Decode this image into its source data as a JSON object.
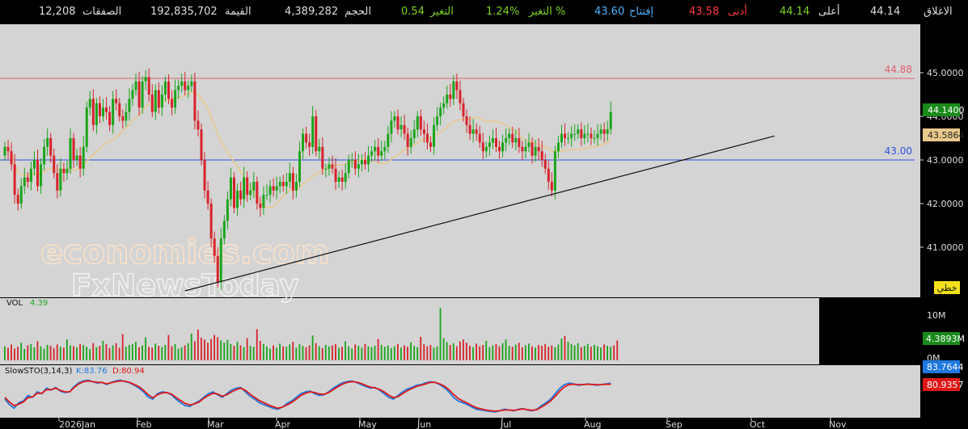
{
  "quote_bar": {
    "close_label": "الاغلاق",
    "close_value": "44.14",
    "high_label": "أعلى",
    "high_value": "44.14",
    "low_label": "أدنى",
    "low_value": "43.58",
    "open_label": "إفتتاح",
    "open_value": "43.60",
    "change_pct_label": "التغير %",
    "change_pct_value": "1.24%",
    "change_label": "التغير",
    "change_value": "0.54",
    "volume_label": "الحجم",
    "volume_value": "4,389,282",
    "value_label": "القيمة",
    "value_value": "192,835,702",
    "trades_label": "الصفقات",
    "trades_value": "12,208"
  },
  "colors": {
    "up": "#1aa51a",
    "down": "#d8222a",
    "panel_bg": "#d4d4d4",
    "ma": "#e9c98c",
    "resistance": "#e06070",
    "support": "#3050e0",
    "k_line": "#1e78e0",
    "d_line": "#e01818",
    "label_green": "#1a8a1a"
  },
  "watermark": {
    "line1": "economies.com",
    "line2": "FxNewsToday"
  },
  "chart_type_label": "خطي",
  "chart_data": {
    "type": "candlestick",
    "price_axis": {
      "ticks": [
        "45.0000",
        "44.0000",
        "43.0000",
        "42.0000",
        "41.0000"
      ],
      "range": [
        39.6,
        45.6
      ]
    },
    "x_axis": {
      "labels": [
        "2026Jan",
        "Feb",
        "Mar",
        "Apr",
        "May",
        "Jun",
        "Jul",
        "Aug",
        "Sep",
        "Oct",
        "Nov"
      ]
    },
    "last_price": "44.1400",
    "ma_value": "43.5864",
    "levels": [
      {
        "value": 44.88,
        "label": "44.88"
      },
      {
        "value": 43.0,
        "label": "43.00"
      }
    ],
    "trendline": {
      "from": {
        "index": 55,
        "price": 40.0
      },
      "to": {
        "index": 235,
        "price": 43.55
      }
    },
    "closes": [
      43.3,
      43.2,
      42.9,
      42.2,
      42.0,
      42.4,
      42.6,
      42.5,
      42.8,
      43.0,
      42.4,
      42.9,
      43.3,
      43.5,
      43.1,
      42.7,
      42.3,
      42.8,
      42.7,
      42.8,
      43.5,
      43.0,
      43.1,
      42.8,
      43.3,
      44.2,
      44.4,
      43.8,
      44.3,
      44.0,
      44.2,
      44.1,
      43.8,
      44.4,
      44.3,
      44.0,
      43.9,
      44.1,
      44.4,
      44.6,
      44.8,
      44.2,
      44.8,
      44.9,
      44.5,
      44.1,
      44.6,
      44.2,
      44.5,
      44.8,
      44.4,
      44.2,
      44.6,
      44.7,
      44.8,
      44.6,
      44.7,
      44.8,
      43.9,
      43.7,
      43.0,
      42.3,
      42.0,
      41.2,
      40.8,
      40.2,
      41.2,
      41.6,
      42.1,
      42.6,
      41.9,
      42.3,
      42.1,
      42.6,
      42.2,
      42.3,
      42.5,
      42.0,
      41.9,
      42.2,
      42.2,
      42.4,
      42.3,
      42.4,
      42.5,
      42.4,
      42.5,
      42.7,
      42.3,
      42.5,
      43.2,
      43.6,
      43.4,
      43.3,
      44.0,
      43.2,
      43.3,
      42.8,
      42.8,
      42.9,
      42.8,
      42.5,
      42.6,
      42.5,
      42.7,
      43.0,
      43.0,
      42.8,
      42.9,
      43.0,
      42.9,
      43.1,
      43.2,
      43.3,
      43.1,
      43.2,
      43.3,
      43.6,
      43.9,
      44.0,
      43.7,
      43.8,
      43.6,
      43.3,
      43.5,
      43.7,
      44.0,
      43.7,
      43.6,
      43.4,
      43.3,
      43.8,
      44.0,
      44.2,
      44.3,
      44.5,
      44.4,
      44.8,
      44.6,
      44.3,
      44.0,
      43.8,
      43.6,
      43.7,
      43.6,
      43.4,
      43.2,
      43.3,
      43.4,
      43.5,
      43.3,
      43.2,
      43.4,
      43.5,
      43.6,
      43.4,
      43.5,
      43.3,
      43.2,
      43.3,
      43.4,
      43.1,
      43.3,
      43.2,
      43.0,
      42.8,
      42.5,
      42.3,
      43.2,
      43.4,
      43.6,
      43.5,
      43.5,
      43.6,
      43.6,
      43.7,
      43.5,
      43.6,
      43.6,
      43.5,
      43.5,
      43.6,
      43.7,
      43.6,
      43.7,
      44.1
    ],
    "volume_axis": {
      "ticks": [
        "10M",
        "0M"
      ],
      "current": "4.3893M",
      "indicator_label": "VOL",
      "indicator_value": "4.39"
    },
    "volumes": [
      3.1,
      2.8,
      3.5,
      2.6,
      3.0,
      3.9,
      2.5,
      3.3,
      3.6,
      2.9,
      4.2,
      3.1,
      2.6,
      3.4,
      3.2,
      2.7,
      3.5,
      3.0,
      2.8,
      4.6,
      3.3,
      3.1,
      2.9,
      3.6,
      3.4,
      3.0,
      2.5,
      3.8,
      2.9,
      3.2,
      4.3,
      3.6,
      2.7,
      3.3,
      3.8,
      2.8,
      5.8,
      3.0,
      3.4,
      3.6,
      4.1,
      2.9,
      3.3,
      5.1,
      3.0,
      2.8,
      3.7,
      3.2,
      2.9,
      3.4,
      5.6,
      3.1,
      3.6,
      2.6,
      2.9,
      3.3,
      3.8,
      5.9,
      4.2,
      6.8,
      5.0,
      4.6,
      3.9,
      4.7,
      5.6,
      5.1,
      4.4,
      3.9,
      4.5,
      3.6,
      3.2,
      4.1,
      3.3,
      2.9,
      4.9,
      3.2,
      3.0,
      6.9,
      4.3,
      3.6,
      3.1,
      2.6,
      3.3,
      2.8,
      3.7,
      3.1,
      3.0,
      3.5,
      4.1,
      2.8,
      3.6,
      3.2,
      2.9,
      3.3,
      5.5,
      3.8,
      3.1,
      2.7,
      3.4,
      3.1,
      3.3,
      3.6,
      2.8,
      3.0,
      4.2,
      3.1,
      2.6,
      3.5,
      3.2,
      2.8,
      3.6,
      3.1,
      2.9,
      3.2,
      4.7,
      3.4,
      3.0,
      3.3,
      2.7,
      3.1,
      3.6,
      2.8,
      3.3,
      3.0,
      4.0,
      3.2,
      2.9,
      5.2,
      3.6,
      3.1,
      3.4,
      2.8,
      3.1,
      11.6,
      4.9,
      4.0,
      3.4,
      3.8,
      3.1,
      4.2,
      4.6,
      3.9,
      3.2,
      2.9,
      3.7,
      3.1,
      3.4,
      4.3,
      2.9,
      3.3,
      3.6,
      3.1,
      3.8,
      4.6,
      3.2,
      3.0,
      3.5,
      3.9,
      2.9,
      3.3,
      3.7,
      3.1,
      2.8,
      3.4,
      3.2,
      3.6,
      3.0,
      3.3,
      2.9,
      3.5,
      4.8,
      5.4,
      4.1,
      3.6,
      3.3,
      3.8,
      2.9,
      3.2,
      3.6,
      3.0,
      3.4,
      3.1,
      2.8,
      3.5,
      3.2,
      3.0,
      3.3,
      4.39
    ],
    "stoch": {
      "label": "SlowSTO(3,14,3)",
      "k_label": "K:83.76",
      "d_label": "D:80.94",
      "k_value": "83.7644",
      "d_value": "80.9357",
      "range": [
        0,
        100
      ],
      "k_series": [
        40,
        25,
        15,
        30,
        35,
        50,
        45,
        60,
        55,
        70,
        65,
        72,
        62,
        58,
        60,
        75,
        85,
        90,
        92,
        88,
        84,
        86,
        80,
        86,
        90,
        92,
        88,
        85,
        78,
        70,
        60,
        45,
        40,
        55,
        60,
        58,
        52,
        40,
        30,
        22,
        20,
        28,
        35,
        45,
        55,
        60,
        52,
        45,
        55,
        65,
        70,
        72,
        60,
        48,
        40,
        30,
        25,
        20,
        15,
        12,
        18,
        28,
        35,
        45,
        55,
        60,
        62,
        55,
        50,
        52,
        60,
        70,
        78,
        85,
        88,
        90,
        86,
        80,
        75,
        70,
        72,
        65,
        55,
        45,
        40,
        50,
        60,
        68,
        72,
        78,
        80,
        85,
        88,
        86,
        80,
        72,
        60,
        45,
        35,
        30,
        25,
        18,
        12,
        10,
        8,
        6,
        5,
        8,
        12,
        10,
        8,
        12,
        14,
        10,
        8,
        12,
        22,
        30,
        40,
        55,
        70,
        80,
        84,
        82,
        78,
        80,
        82,
        80,
        78,
        80,
        82,
        83.76
      ],
      "d_series": [
        45,
        32,
        22,
        26,
        32,
        44,
        46,
        56,
        56,
        66,
        66,
        70,
        64,
        60,
        60,
        72,
        82,
        88,
        90,
        88,
        86,
        86,
        82,
        85,
        88,
        90,
        89,
        86,
        80,
        74,
        64,
        52,
        44,
        52,
        57,
        58,
        54,
        45,
        36,
        28,
        24,
        27,
        32,
        42,
        50,
        56,
        54,
        48,
        52,
        60,
        66,
        70,
        64,
        54,
        45,
        36,
        30,
        24,
        19,
        15,
        18,
        24,
        31,
        40,
        50,
        56,
        60,
        58,
        54,
        53,
        58,
        66,
        74,
        81,
        86,
        88,
        87,
        83,
        78,
        73,
        71,
        67,
        60,
        51,
        44,
        47,
        55,
        63,
        69,
        75,
        78,
        82,
        86,
        86,
        82,
        76,
        66,
        53,
        42,
        35,
        29,
        22,
        16,
        13,
        10,
        8,
        7,
        8,
        10,
        10,
        9,
        11,
        13,
        11,
        9,
        11,
        18,
        26,
        35,
        48,
        62,
        74,
        80,
        81,
        80,
        80,
        81,
        80.5,
        79.8,
        80.1,
        80.6,
        80.94
      ]
    }
  }
}
